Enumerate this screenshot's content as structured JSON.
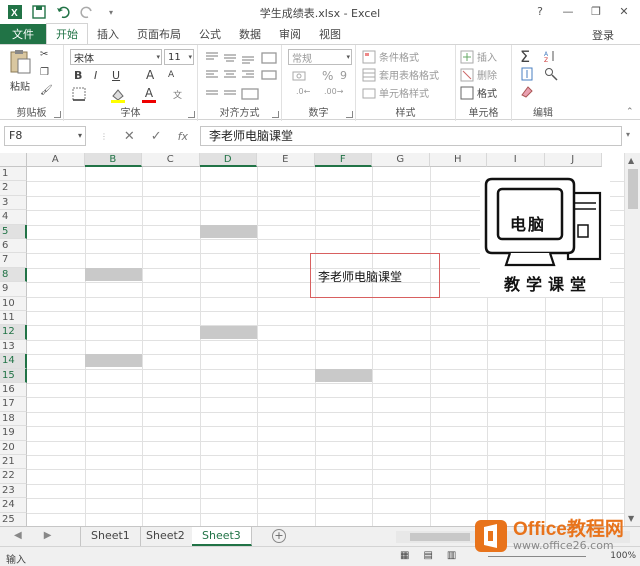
{
  "window": {
    "title": "学生成绩表.xlsx - Excel",
    "controls": [
      "?",
      "—",
      "❐",
      "✕"
    ]
  },
  "tabs": [
    "文件",
    "开始",
    "插入",
    "页面布局",
    "公式",
    "数据",
    "审阅",
    "视图"
  ],
  "active_tab": "开始",
  "account": "登录",
  "ribbon": {
    "clipboard": {
      "paste": "粘贴",
      "label": "剪贴板"
    },
    "font": {
      "name": "宋体",
      "size": "11",
      "bold": "B",
      "italic": "I",
      "underline": "U",
      "grow": "A",
      "shrink": "A",
      "color_letter": "A",
      "label": "字体"
    },
    "alignment": {
      "label": "对齐方式"
    },
    "number": {
      "format": "常规",
      "percent": "%",
      "comma": "9",
      "label": "数字"
    },
    "styles": {
      "conditional": "条件格式",
      "table": "套用表格格式",
      "cell": "单元格样式",
      "label": "样式"
    },
    "cells": {
      "insert": "插入",
      "delete": "删除",
      "format": "格式",
      "label": "单元格"
    },
    "editing": {
      "sum": "Σ",
      "label": "编辑"
    }
  },
  "formula_bar": {
    "name_box": "F8",
    "fx": "fx",
    "value": "李老师电脑课堂"
  },
  "columns": [
    "A",
    "B",
    "C",
    "D",
    "E",
    "F",
    "G",
    "H",
    "I",
    "J"
  ],
  "selected_columns": [
    "B",
    "D",
    "F"
  ],
  "rows": [
    "1",
    "2",
    "3",
    "4",
    "5",
    "6",
    "7",
    "8",
    "9",
    "10",
    "11",
    "12",
    "13",
    "14",
    "15",
    "16",
    "17",
    "18",
    "19",
    "20",
    "21",
    "22",
    "23",
    "24",
    "25"
  ],
  "selected_rows": [
    "5",
    "8",
    "12",
    "14",
    "15"
  ],
  "cells": {
    "F8": "李老师电脑课堂"
  },
  "logo": {
    "screen_text": "电脑",
    "caption": "教学课堂"
  },
  "sheets": [
    "Sheet1",
    "Sheet2",
    "Sheet3"
  ],
  "active_sheet": "Sheet3",
  "status": {
    "mode": "输入",
    "zoom": "100%"
  },
  "watermark": {
    "brand": "Office教程网",
    "url": "www.office26.com"
  },
  "colors": {
    "accent": "#217346",
    "fill": "#c9c9c9",
    "selection_box": "#d86060"
  }
}
